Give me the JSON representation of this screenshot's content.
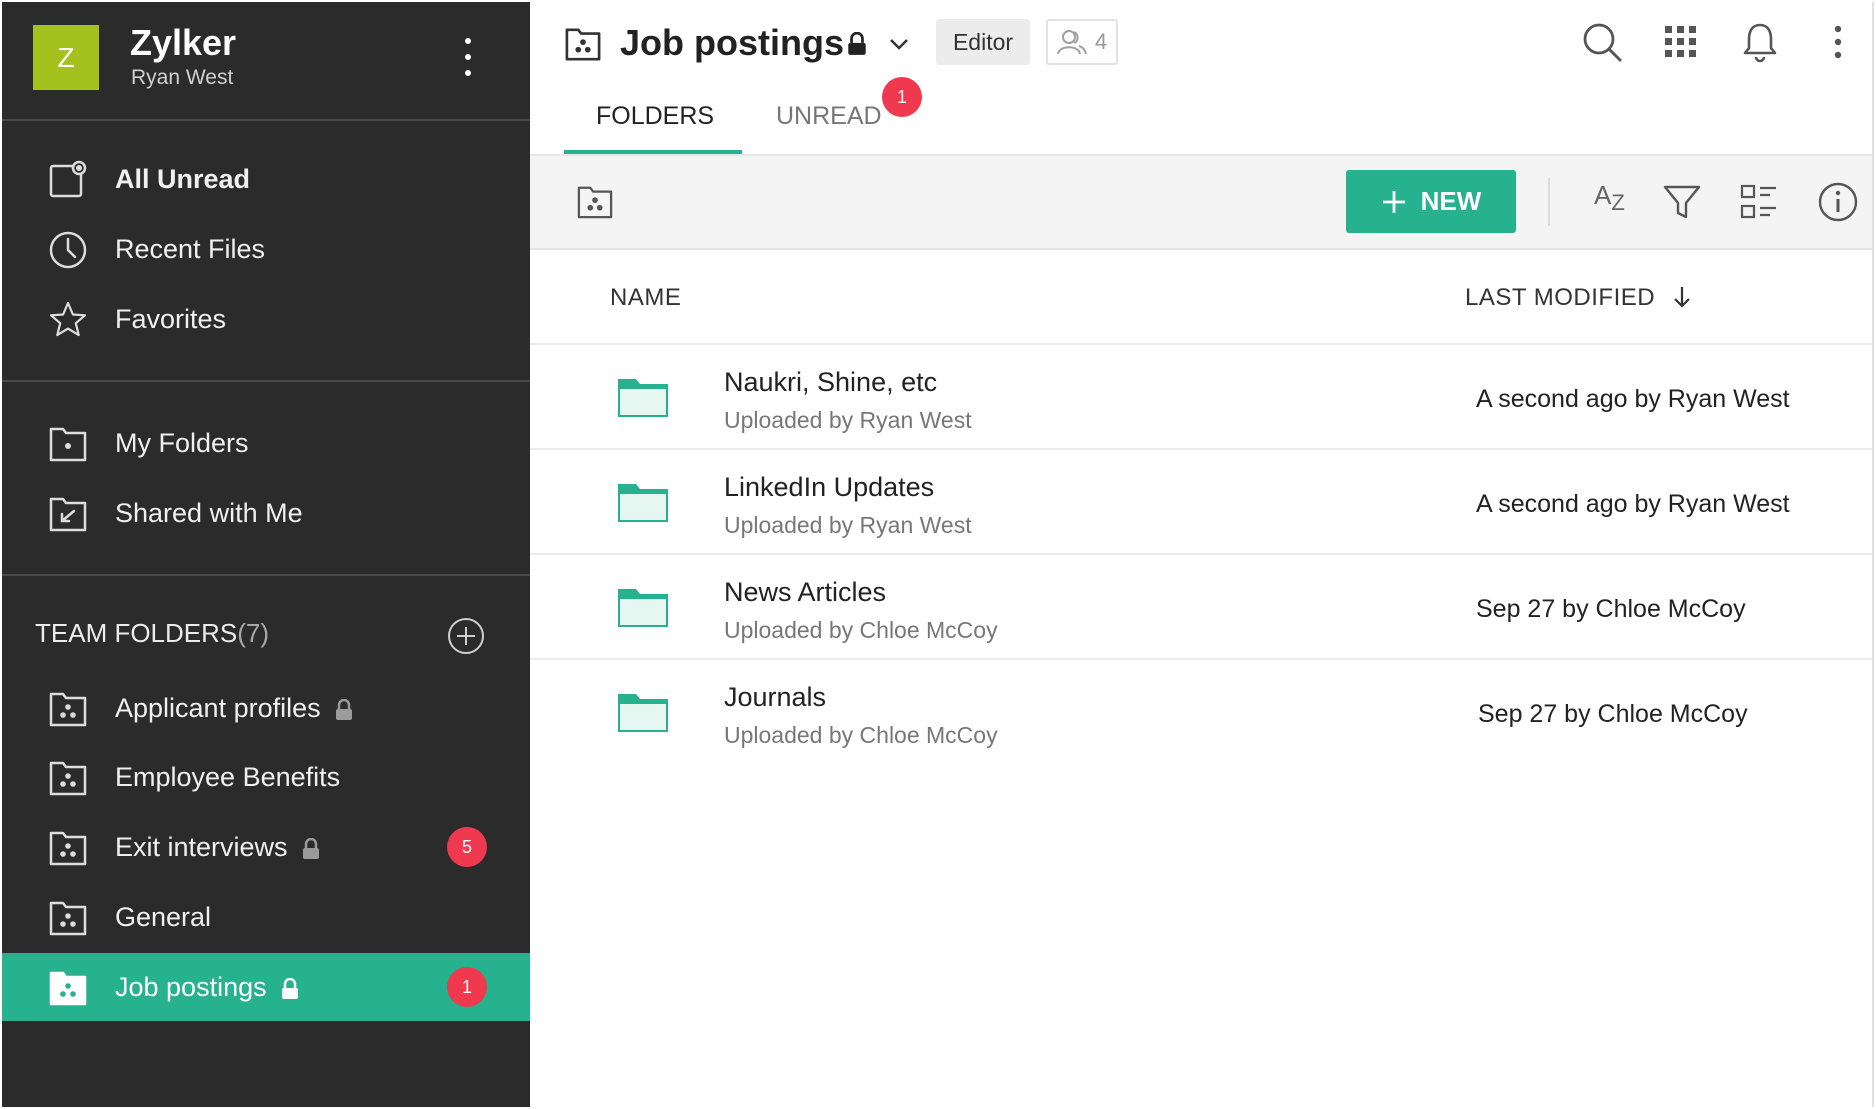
{
  "org": {
    "logo_letter": "Z",
    "name": "Zylker",
    "user": "Ryan West"
  },
  "sidebar": {
    "quick": [
      {
        "label": "All Unread",
        "icon": "unread-icon"
      },
      {
        "label": "Recent Files",
        "icon": "clock-icon"
      },
      {
        "label": "Favorites",
        "icon": "star-icon"
      }
    ],
    "personal": [
      {
        "label": "My Folders",
        "icon": "my-folder-icon"
      },
      {
        "label": "Shared with Me",
        "icon": "shared-folder-icon"
      }
    ],
    "team_title": "TEAM FOLDERS",
    "team_count": "(7)",
    "team": [
      {
        "label": "Applicant profiles",
        "locked": true,
        "badge": ""
      },
      {
        "label": "Employee Benefits",
        "locked": false,
        "badge": ""
      },
      {
        "label": "Exit interviews",
        "locked": true,
        "badge": "5"
      },
      {
        "label": "General",
        "locked": false,
        "badge": ""
      },
      {
        "label": "Job postings",
        "locked": true,
        "badge": "1",
        "active": true
      }
    ]
  },
  "header": {
    "title": "Job postings",
    "role": "Editor",
    "members_count": "4"
  },
  "tabs": {
    "folders": "FOLDERS",
    "unread": "UNREAD",
    "unread_badge": "1"
  },
  "toolbar": {
    "new_label": "NEW",
    "sort_icon_text": "A",
    "sort_icon_sub": "Z"
  },
  "columns": {
    "name": "NAME",
    "last_modified": "LAST MODIFIED"
  },
  "files": [
    {
      "name": "Naukri, Shine, etc",
      "uploaded": "Uploaded by Ryan West",
      "modified": "A second ago by Ryan West"
    },
    {
      "name": "LinkedIn Updates",
      "uploaded": "Uploaded by Ryan West",
      "modified": "A second ago by Ryan West"
    },
    {
      "name": "News Articles",
      "uploaded": "Uploaded by Chloe McCoy",
      "modified": "Sep 27 by Chloe McCoy"
    },
    {
      "name": "Journals",
      "uploaded": "Uploaded by Chloe McCoy",
      "modified": "Sep 27 by Chloe McCoy"
    }
  ],
  "colors": {
    "accent": "#26b18f",
    "sidebar_bg": "#2b2b2b",
    "badge": "#f0384f",
    "logo": "#a4c11d",
    "folder": "#26b18f"
  }
}
